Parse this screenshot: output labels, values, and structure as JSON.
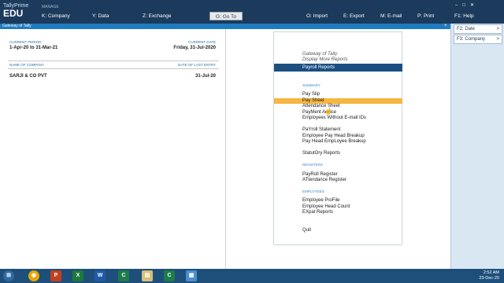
{
  "brand": {
    "line1": "TallyPrime",
    "line2": "EDU"
  },
  "top": {
    "manage": "MANAGE",
    "goto": "G: Go To",
    "menu": [
      {
        "key": "K",
        "label": "K: Company"
      },
      {
        "key": "Y",
        "label": "Y: Data"
      },
      {
        "key": "Z",
        "label": "Z: Exchange"
      },
      {
        "key": "O",
        "label": "O: Import"
      },
      {
        "key": "E",
        "label": "E: Export"
      },
      {
        "key": "M",
        "label": "M: E-mail"
      },
      {
        "key": "P",
        "label": "P: Print"
      },
      {
        "key": "F1",
        "label": "F1: Help"
      }
    ]
  },
  "titlebar": {
    "title": "Gateway of Tally",
    "close": "×"
  },
  "right_panel": {
    "items": [
      "F2: Date",
      "F3: Company"
    ],
    "arrow": ">"
  },
  "left": {
    "current_period_label": "CURRENT PERIOD",
    "current_period": "1-Apr-20 to 31-Mar-21",
    "current_date_label": "CURRENT DATE",
    "current_date": "Friday, 31-Jul-2020",
    "name_label": "NAME OF COMPANY",
    "last_entry_label": "DATE OF LAST ENTRY",
    "company": "SARJI & CO PVT",
    "last_entry": "31-Jul-20"
  },
  "gateway": {
    "breadcrumb1": "Gateway of Tally",
    "breadcrumb2": "Display More Reports",
    "panel_title": "Payroll Reports",
    "summary_label": "SUMMARY",
    "summary": [
      "Pay Slip",
      "Pay Sheet",
      "Attendance Sheet",
      "PayMent Advice",
      "Employees Without E-mail IDs"
    ],
    "group2": [
      "PaYroll Statement",
      "Employee Pay Head Breakup",
      "Pay Head EmpLoyee Breakup"
    ],
    "statutory": "StatutOry Reports",
    "registers_label": "REGISTERS",
    "registers": [
      "PayRoll Register",
      "ATtendance Register"
    ],
    "employees_label": "EMPLOYEES",
    "employees": [
      "Employee ProFile",
      "Employee Head Count",
      "EXpat Reports"
    ],
    "quit": "Quit",
    "selected": "Pay Sheet"
  },
  "taskbar": {
    "icons": [
      "start",
      "chrome",
      "powerpoint",
      "excel",
      "word",
      "tally",
      "files",
      "tally2",
      "app"
    ],
    "time": "2:52 AM",
    "date": "23-Dec-20"
  }
}
